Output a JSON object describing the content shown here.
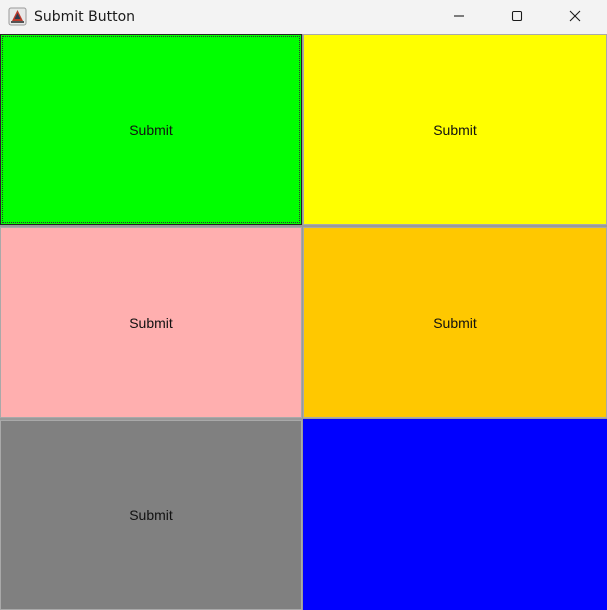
{
  "window": {
    "title": "Submit Button",
    "controls": {
      "minimize": "minimize-icon",
      "maximize": "maximize-icon",
      "close": "close-icon"
    }
  },
  "colors": {
    "green": "#00ff00",
    "yellow": "#ffff00",
    "pink": "#ffafaf",
    "orange": "#ffc800",
    "gray": "#808080",
    "blue": "#0000ff"
  },
  "buttons": [
    {
      "label": "Submit",
      "color": "#00ff00"
    },
    {
      "label": "Submit",
      "color": "#ffff00"
    },
    {
      "label": "Submit",
      "color": "#ffafaf"
    },
    {
      "label": "Submit",
      "color": "#ffc800"
    },
    {
      "label": "Submit",
      "color": "#808080"
    },
    {
      "label": "",
      "color": "#0000ff"
    }
  ]
}
